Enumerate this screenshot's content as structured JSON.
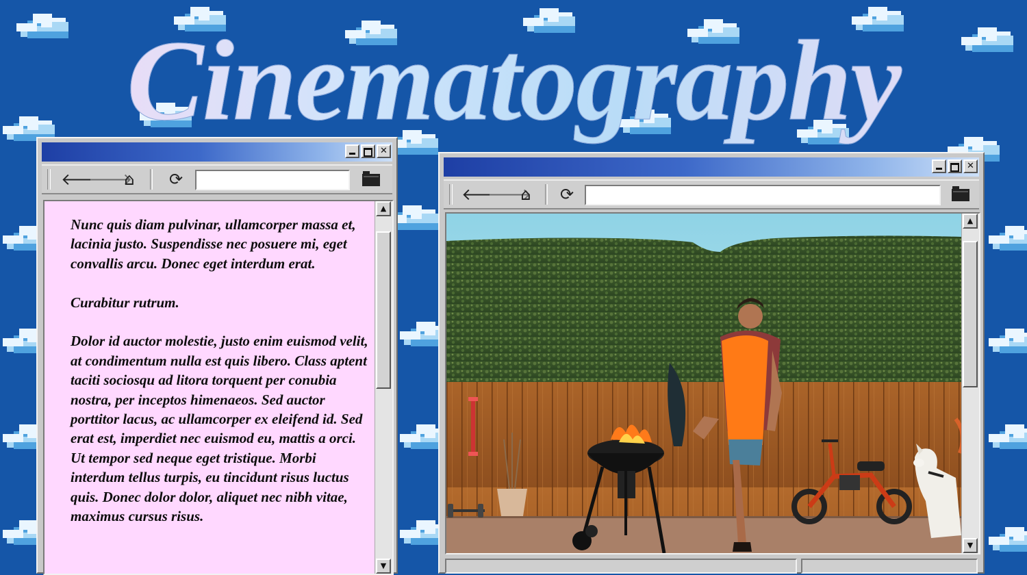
{
  "page": {
    "title": "Cinematography",
    "background": "pixel sky with clouds",
    "colors": {
      "sky": "#1556a8",
      "cloud": "#eaf6ff",
      "window": "#c9c9c9",
      "titlebar_start": "#1e3fa5",
      "text_panel": "#ffd8ff"
    }
  },
  "left_window": {
    "titlebar": {
      "buttons": [
        "minimize",
        "maximize",
        "close"
      ]
    },
    "toolbar": {
      "back_icon": "arrow-left-icon",
      "forward_icon": "arrow-right-icon",
      "home_icon": "home-icon",
      "refresh_icon": "refresh-icon",
      "address_value": "",
      "folder_icon": "folder-icon"
    },
    "paragraphs": [
      "Nunc quis diam pulvinar, ullamcorper massa et, lacinia justo. Suspendisse nec posuere mi, eget convallis arcu. Donec eget interdum erat.",
      "Curabitur rutrum.",
      "Dolor id auctor molestie, justo enim euismod velit, at condimentum nulla est quis libero. Class aptent taciti sociosqu ad litora torquent per conubia nostra, per inceptos himenaeos. Sed auctor porttitor lacus, ac ullamcorper ex eleifend id. Sed erat est, imperdiet nec euismod eu, mattis a orci. Ut tempor sed neque eget tristique. Morbi interdum tellus turpis, eu tincidunt risus luctus quis. Donec dolor dolor, aliquet nec nibh vitae, maximus cursus risus."
    ]
  },
  "right_window": {
    "titlebar": {
      "buttons": [
        "minimize",
        "maximize",
        "close"
      ]
    },
    "toolbar": {
      "back_icon": "arrow-left-icon",
      "forward_icon": "arrow-right-icon",
      "home_icon": "home-icon",
      "refresh_icon": "refresh-icon",
      "address_value": "",
      "folder_icon": "folder-icon"
    },
    "image": {
      "description_icon": "film-still-image",
      "alt": ""
    }
  }
}
